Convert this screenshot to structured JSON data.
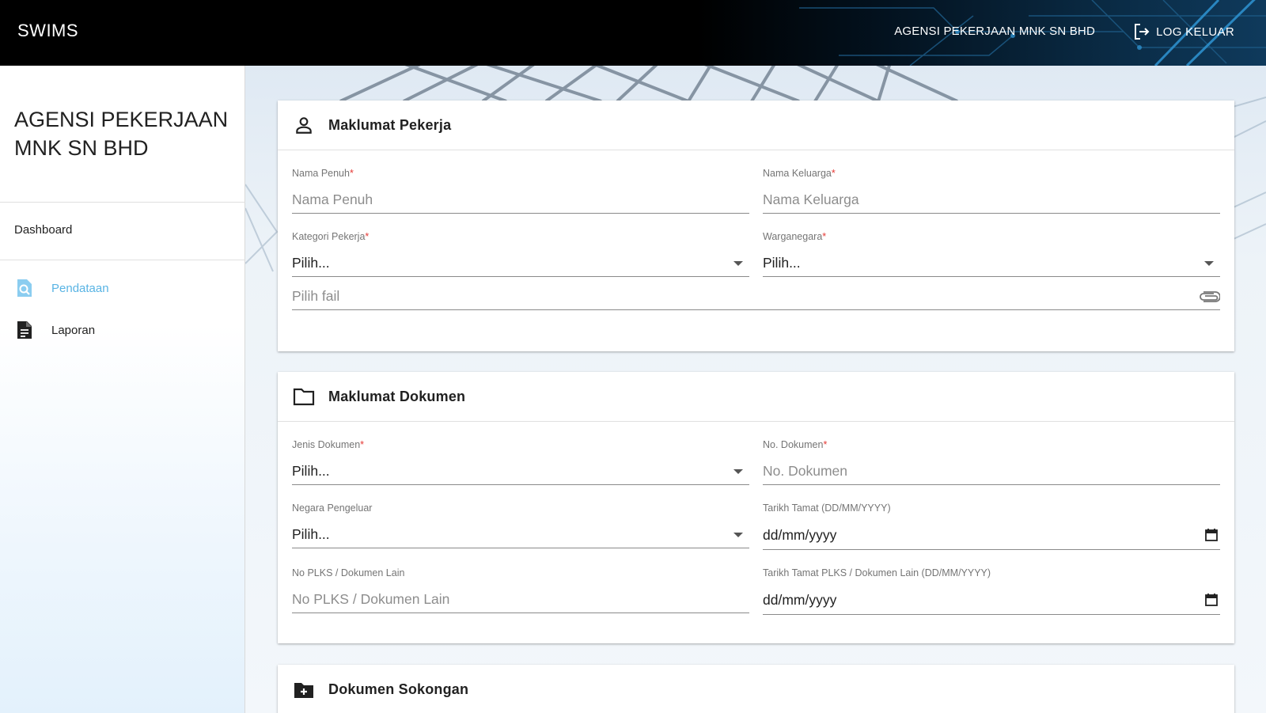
{
  "app": {
    "brand": "SWIMS",
    "agency_name": "AGENSI PEKERJAAN MNK SN BHD",
    "logout_label": "LOG KELUAR"
  },
  "sidebar": {
    "agency_name": "AGENSI PEKERJAAN MNK SN BHD",
    "dashboard_label": "Dashboard",
    "items": [
      {
        "label": "Pendataan",
        "icon": "search-document-icon",
        "active": true
      },
      {
        "label": "Laporan",
        "icon": "document-icon",
        "active": false
      }
    ]
  },
  "sections": {
    "worker": {
      "title": "Maklumat Pekerja",
      "icon": "person-icon",
      "fields": {
        "full_name": {
          "label": "Nama Penuh",
          "required_mark": "*",
          "placeholder": "Nama Penuh"
        },
        "family_name": {
          "label": "Nama Keluarga",
          "required_mark": "*",
          "placeholder": "Nama Keluarga"
        },
        "category": {
          "label": "Kategori Pekerja",
          "required_mark": "*",
          "value": "Pilih..."
        },
        "citizenship": {
          "label": "Warganegara",
          "required_mark": "*",
          "value": "Pilih..."
        },
        "file": {
          "placeholder": "Pilih fail",
          "icon": "paperclip-icon"
        }
      }
    },
    "document": {
      "title": "Maklumat Dokumen",
      "icon": "folder-icon",
      "fields": {
        "doc_type": {
          "label": "Jenis Dokumen",
          "required_mark": "*",
          "value": "Pilih..."
        },
        "doc_no": {
          "label": "No. Dokumen",
          "required_mark": "*",
          "placeholder": "No. Dokumen"
        },
        "issuing_country": {
          "label": "Negara Pengeluar",
          "value": "Pilih..."
        },
        "expiry_date": {
          "label": "Tarikh Tamat (DD/MM/YYYY)",
          "value": "dd/mm/yyyy"
        },
        "plks_no": {
          "label": "No PLKS / Dokumen Lain",
          "placeholder": "No PLKS / Dokumen Lain"
        },
        "plks_expiry": {
          "label": "Tarikh Tamat PLKS / Dokumen Lain (DD/MM/YYYY)",
          "value": "dd/mm/yyyy"
        }
      }
    },
    "support": {
      "title": "Dokumen Sokongan",
      "icon": "folder-add-icon"
    }
  },
  "colors": {
    "accent": "#59b4e4",
    "required": "#e53935",
    "topbar": "#000000"
  }
}
